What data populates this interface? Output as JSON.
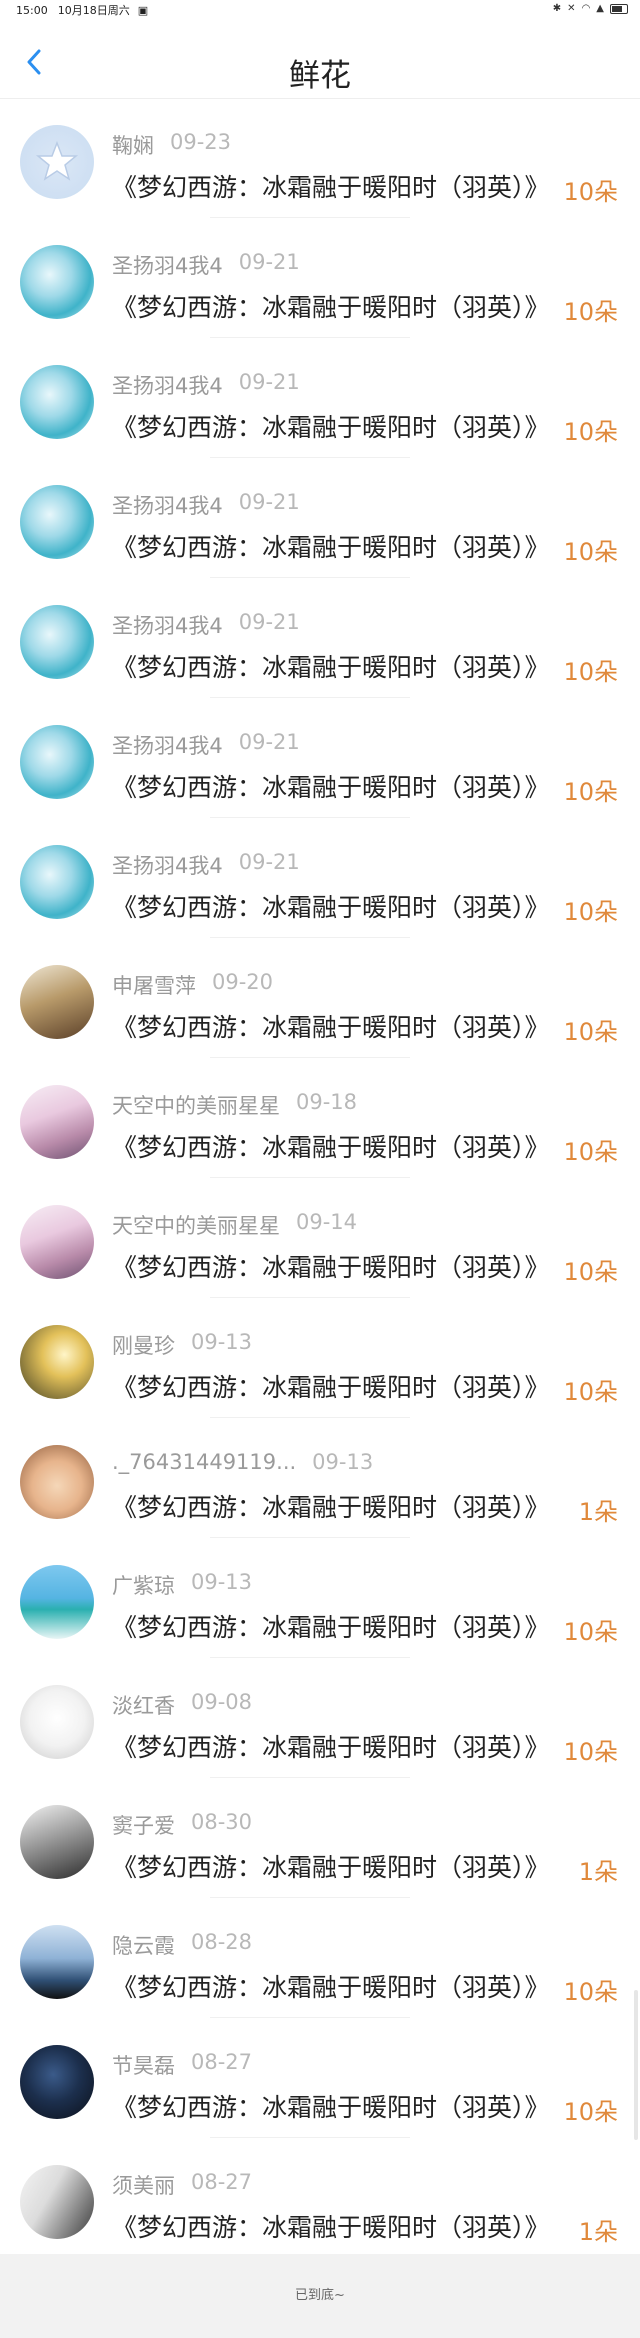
{
  "status_bar": {
    "time": "15:00",
    "date": "10月18日周六"
  },
  "header": {
    "title": "鲜花"
  },
  "entries": [
    {
      "name": "鞠娴",
      "date": "09-23",
      "gift": "《梦幻西游：冰霜融于暖阳时（羽英）》",
      "count": "10朵",
      "avatar": "default-avatar"
    },
    {
      "name": "圣扬羽4我4",
      "date": "09-21",
      "gift": "《梦幻西游：冰霜融于暖阳时（羽英）》",
      "count": "10朵",
      "avatar": "anime-avatar"
    },
    {
      "name": "圣扬羽4我4",
      "date": "09-21",
      "gift": "《梦幻西游：冰霜融于暖阳时（羽英）》",
      "count": "10朵",
      "avatar": "anime-avatar"
    },
    {
      "name": "圣扬羽4我4",
      "date": "09-21",
      "gift": "《梦幻西游：冰霜融于暖阳时（羽英）》",
      "count": "10朵",
      "avatar": "anime-avatar"
    },
    {
      "name": "圣扬羽4我4",
      "date": "09-21",
      "gift": "《梦幻西游：冰霜融于暖阳时（羽英）》",
      "count": "10朵",
      "avatar": "anime-avatar"
    },
    {
      "name": "圣扬羽4我4",
      "date": "09-21",
      "gift": "《梦幻西游：冰霜融于暖阳时（羽英）》",
      "count": "10朵",
      "avatar": "anime-avatar"
    },
    {
      "name": "圣扬羽4我4",
      "date": "09-21",
      "gift": "《梦幻西游：冰霜融于暖阳时（羽英）》",
      "count": "10朵",
      "avatar": "anime-avatar"
    },
    {
      "name": "申屠雪萍",
      "date": "09-20",
      "gift": "《梦幻西游：冰霜融于暖阳时（羽英）》",
      "count": "10朵",
      "avatar": "photo-avatar"
    },
    {
      "name": "天空中的美丽星星",
      "date": "09-18",
      "gift": "《梦幻西游：冰霜融于暖阳时（羽英）》",
      "count": "10朵",
      "avatar": "pink-avatar"
    },
    {
      "name": "天空中的美丽星星",
      "date": "09-14",
      "gift": "《梦幻西游：冰霜融于暖阳时（羽英）》",
      "count": "10朵",
      "avatar": "pink-avatar"
    },
    {
      "name": "刚曼珍",
      "date": "09-13",
      "gift": "《梦幻西游：冰霜融于暖阳时（羽英）》",
      "count": "10朵",
      "avatar": "sunset-avatar"
    },
    {
      "name": "._76431449119...",
      "date": "09-13",
      "gift": "《梦幻西游：冰霜融于暖阳时（羽英）》",
      "count": "1朵",
      "avatar": "child-avatar"
    },
    {
      "name": "广紫琼",
      "date": "09-13",
      "gift": "《梦幻西游：冰霜融于暖阳时（羽英）》",
      "count": "10朵",
      "avatar": "beach-avatar"
    },
    {
      "name": "淡红香",
      "date": "09-08",
      "gift": "《梦幻西游：冰霜融于暖阳时（羽英）》",
      "count": "10朵",
      "avatar": "cartoon-avatar"
    },
    {
      "name": "窦子爱",
      "date": "08-30",
      "gift": "《梦幻西游：冰霜融于暖阳时（羽英）》",
      "count": "1朵",
      "avatar": "bw-anime-avatar"
    },
    {
      "name": "隐云霞",
      "date": "08-28",
      "gift": "《梦幻西游：冰霜融于暖阳时（羽英）》",
      "count": "10朵",
      "avatar": "car-avatar"
    },
    {
      "name": "节昊磊",
      "date": "08-27",
      "gift": "《梦幻西游：冰霜融于暖阳时（羽英）》",
      "count": "10朵",
      "avatar": "dark-avatar"
    },
    {
      "name": "须美丽",
      "date": "08-27",
      "gift": "《梦幻西游：冰霜融于暖阳时（羽英）》",
      "count": "1朵",
      "avatar": "calligraphy-avatar"
    }
  ],
  "footer": {
    "text": "已到底~"
  },
  "colors": {
    "accent": "#2b8ff0",
    "count": "#e0893b",
    "name": "#9a9a9a",
    "date": "#b8b8b8"
  }
}
